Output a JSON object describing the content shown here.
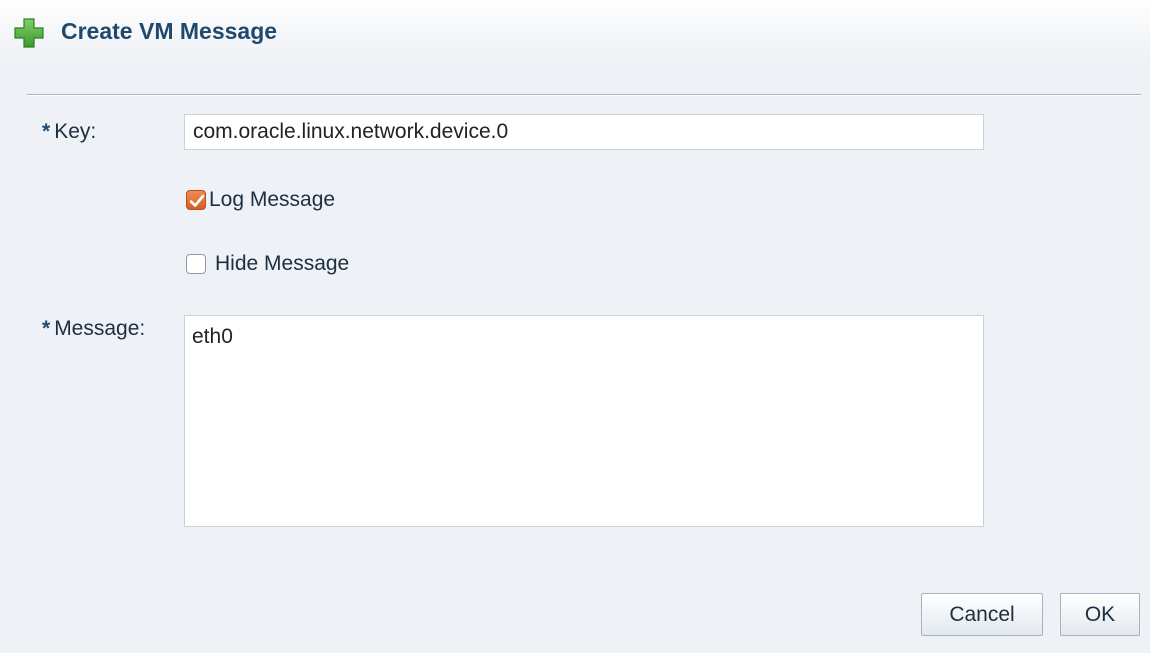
{
  "dialog": {
    "title": "Create VM Message",
    "header_icon": "plus-icon"
  },
  "form": {
    "required_marker": "*",
    "key_label": "Key:",
    "key_value": "com.oracle.linux.network.device.0",
    "log_message_label": "Log Message",
    "log_message_checked": true,
    "hide_message_label": "Hide Message",
    "hide_message_checked": false,
    "message_label": "Message:",
    "message_value": "eth0"
  },
  "buttons": {
    "cancel_label": "Cancel",
    "ok_label": "OK"
  },
  "colors": {
    "title_text": "#1f4a6e",
    "checkbox_checked": "#e0703a",
    "plus_icon": "#4aab3c"
  }
}
